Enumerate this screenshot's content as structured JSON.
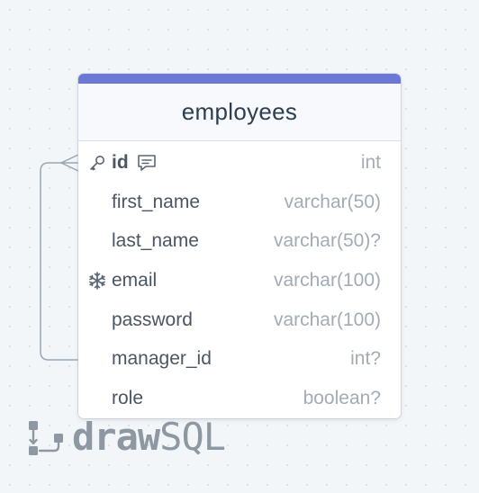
{
  "table": {
    "name": "employees",
    "accent_color": "#6b78d6",
    "columns": [
      {
        "name": "id",
        "type": "int",
        "primary_key": true,
        "has_comment": true,
        "icon": "key-icon"
      },
      {
        "name": "first_name",
        "type": "varchar(50)"
      },
      {
        "name": "last_name",
        "type": "varchar(50)?"
      },
      {
        "name": "email",
        "type": "varchar(100)",
        "icon": "snowflake-icon"
      },
      {
        "name": "password",
        "type": "varchar(100)"
      },
      {
        "name": "manager_id",
        "type": "int?"
      },
      {
        "name": "role",
        "type": "boolean?"
      }
    ]
  },
  "relation": {
    "from": "manager_id",
    "to": "id"
  },
  "brand": {
    "part1": "draw",
    "part2": "SQL"
  }
}
